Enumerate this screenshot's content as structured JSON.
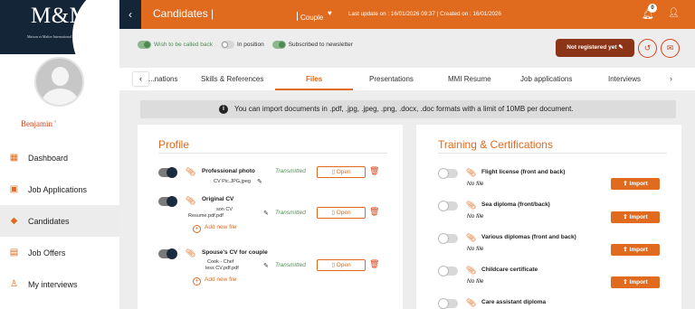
{
  "brand": {
    "logo": "M&M",
    "tagline": "Maison et Maître International"
  },
  "user": {
    "name": "Benjamin '"
  },
  "nav": [
    {
      "label": "Dashboard",
      "icon": "dashboard-icon"
    },
    {
      "label": "Job Applications",
      "icon": "portfolio-icon"
    },
    {
      "label": "Candidates",
      "icon": "graduation-cap-icon"
    },
    {
      "label": "Job Offers",
      "icon": "clipboard-icon"
    },
    {
      "label": "My interviews",
      "icon": "person-icon"
    }
  ],
  "header": {
    "title": "Candidates |",
    "couple": "Couple",
    "update_info": "Last update on : 16/01/2026 09:37 | Created on : 16/01/2026",
    "notification_count": "0"
  },
  "status_toggles": [
    {
      "label": "Wish to be called back",
      "on": true
    },
    {
      "label": "In position",
      "on": false
    },
    {
      "label": "Subscribed to newsletter",
      "on": true
    }
  ],
  "not_registered_label": "Not registered yet",
  "tabs": [
    "...nations",
    "Skills & References",
    "Files",
    "Presentations",
    "MMI Resume",
    "Job applications",
    "Interviews"
  ],
  "active_tab": "Files",
  "info_banner": "You can import documents in .pdf, .jpg, .jpeg, .png, .docx, .doc formats with a limit of 10MB per document.",
  "profile": {
    "title": "Profile",
    "documents": [
      {
        "title": "Professional photo",
        "file": "CV Pic.JPG.jpeg",
        "status": "Transmitted",
        "action": "Open",
        "enabled": true
      },
      {
        "title": "Original CV",
        "file_line1": "son CV",
        "file_line2": "Resume.pdf.pdf",
        "status": "Transmitted",
        "action": "Open",
        "enabled": true,
        "add_label": "Add new file"
      },
      {
        "title": "Spouse's CV for couple",
        "file_line1": "Cook - Chef",
        "file_line2": "less CV.pdf.pdf",
        "status": "Transmitted",
        "action": "Open",
        "enabled": true,
        "add_label": "Add new file"
      }
    ]
  },
  "training": {
    "title": "Training & Certifications",
    "no_file_label": "No file",
    "import_label": "Import",
    "items": [
      {
        "label": "Flight license (front and back)"
      },
      {
        "label": "Sea diploma (front/back)"
      },
      {
        "label": "Various diplomas (front and back)"
      },
      {
        "label": "Childcare certificate"
      },
      {
        "label": "Care assistant diploma"
      }
    ]
  },
  "colors": {
    "accent": "#e06a1d",
    "navy": "#142538",
    "dark_button": "#8b3418",
    "success": "#5a8f5a"
  }
}
